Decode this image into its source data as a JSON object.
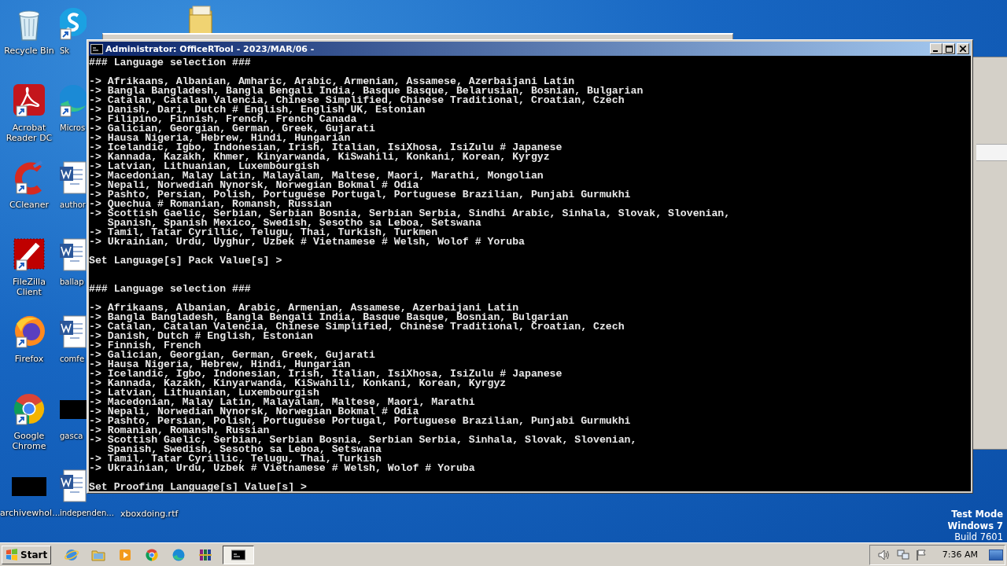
{
  "desktop": {
    "column_1": [
      {
        "label": "Recycle Bin",
        "kind": "recycle-bin",
        "shortcut": false
      },
      {
        "label": "Acrobat Reader DC",
        "kind": "acrobat",
        "shortcut": true
      },
      {
        "label": "CCleaner",
        "kind": "ccleaner",
        "shortcut": true
      },
      {
        "label": "FileZilla Client",
        "kind": "filezilla",
        "shortcut": true
      },
      {
        "label": "Firefox",
        "kind": "firefox",
        "shortcut": true
      },
      {
        "label": "Google Chrome",
        "kind": "chrome",
        "shortcut": true
      },
      {
        "label": "archivewhol...",
        "kind": "thumbnail",
        "shortcut": false
      }
    ],
    "column_2": [
      {
        "label": "Sk",
        "kind": "skype",
        "shortcut": true
      },
      {
        "label": "Micros",
        "kind": "edge",
        "shortcut": true
      },
      {
        "label": "author",
        "kind": "word-document",
        "shortcut": false
      },
      {
        "label": "ballap",
        "kind": "word-document",
        "shortcut": false
      },
      {
        "label": "comfe",
        "kind": "word-document",
        "shortcut": false
      },
      {
        "label": "gasca",
        "kind": "thumbnail",
        "shortcut": false
      },
      {
        "label": "independen...",
        "kind": "word-document",
        "shortcut": false
      }
    ],
    "partly_hidden_folder": {
      "kind": "folder"
    },
    "partly_hidden_file": {
      "label": "xboxdoing.rtf"
    },
    "system_notice": [
      "Test Mode",
      "Windows 7",
      "Build 7601"
    ]
  },
  "console_window": {
    "title": "Administrator: OfficeRTool - 2023/MAR/06 -",
    "sections": [
      {
        "heading": "### Language selection ###",
        "options": [
          "-> Afrikaans, Albanian, Amharic, Arabic, Armenian, Assamese, Azerbaijani Latin",
          "-> Bangla Bangladesh, Bangla Bengali India, Basque Basque, Belarusian, Bosnian, Bulgarian",
          "-> Catalan, Catalan Valencia, Chinese Simplified, Chinese Traditional, Croatian, Czech",
          "-> Danish, Dari, Dutch # English, English UK, Estonian",
          "-> Filipino, Finnish, French, French Canada",
          "-> Galician, Georgian, German, Greek, Gujarati",
          "-> Hausa Nigeria, Hebrew, Hindi, Hungarian",
          "-> Icelandic, Igbo, Indonesian, Irish, Italian, IsiXhosa, IsiZulu # Japanese",
          "-> Kannada, Kazakh, Khmer, Kinyarwanda, KiSwahili, Konkani, Korean, Kyrgyz",
          "-> Latvian, Lithuanian, Luxembourgish",
          "-> Macedonian, Malay Latin, Malayalam, Maltese, Maori, Marathi, Mongolian",
          "-> Nepali, Norwedian Nynorsk, Norwegian Bokmal # Odia",
          "-> Pashto, Persian, Polish, Portuguese Portugal, Portuguese Brazilian, Punjabi Gurmukhi",
          "-> Quechua # Romanian, Romansh, Russian",
          "-> Scottish Gaelic, Serbian, Serbian Bosnia, Serbian Serbia, Sindhi Arabic, Sinhala, Slovak, Slovenian,",
          "   Spanish, Spanish Mexico, Swedish, Sesotho sa Leboa, Setswana",
          "-> Tamil, Tatar Cyrillic, Telugu, Thai, Turkish, Turkmen",
          "-> Ukrainian, Urdu, Uyghur, Uzbek # Vietnamese # Welsh, Wolof # Yoruba"
        ],
        "prompt": "Set Language[s] Pack Value[s] >"
      },
      {
        "heading": "### Language selection ###",
        "options": [
          "-> Afrikaans, Albanian, Arabic, Armenian, Assamese, Azerbaijani Latin",
          "-> Bangla Bangladesh, Bangla Bengali India, Basque Basque, Bosnian, Bulgarian",
          "-> Catalan, Catalan Valencia, Chinese Simplified, Chinese Traditional, Croatian, Czech",
          "-> Danish, Dutch # English, Estonian",
          "-> Finnish, French",
          "-> Galician, Georgian, German, Greek, Gujarati",
          "-> Hausa Nigeria, Hebrew, Hindi, Hungarian",
          "-> Icelandic, Igbo, Indonesian, Irish, Italian, IsiXhosa, IsiZulu # Japanese",
          "-> Kannada, Kazakh, Kinyarwanda, KiSwahili, Konkani, Korean, Kyrgyz",
          "-> Latvian, Lithuanian, Luxembourgish",
          "-> Macedonian, Malay Latin, Malayalam, Maltese, Maori, Marathi",
          "-> Nepali, Norwedian Nynorsk, Norwegian Bokmal # Odia",
          "-> Pashto, Persian, Polish, Portuguese Portugal, Portuguese Brazilian, Punjabi Gurmukhi",
          "-> Romanian, Romansh, Russian",
          "-> Scottish Gaelic, Serbian, Serbian Bosnia, Serbian Serbia, Sinhala, Slovak, Slovenian,",
          "   Spanish, Swedish, Sesotho sa Leboa, Setswana",
          "-> Tamil, Tatar Cyrillic, Telugu, Thai, Turkish",
          "-> Ukrainian, Urdu, Uzbek # Vietnamese # Welsh, Wolof # Yoruba"
        ],
        "prompt": "Set Proofing Language[s] Value[s] >"
      }
    ]
  },
  "taskbar": {
    "start_label": "Start",
    "items": [
      {
        "kind": "internet-explorer",
        "active": false
      },
      {
        "kind": "explorer",
        "active": false
      },
      {
        "kind": "media-player",
        "active": false
      },
      {
        "kind": "chrome",
        "active": false
      },
      {
        "kind": "edge",
        "active": false
      },
      {
        "kind": "winrar",
        "active": false
      },
      {
        "kind": "console",
        "active": true
      }
    ],
    "clock": "7:36 AM"
  }
}
